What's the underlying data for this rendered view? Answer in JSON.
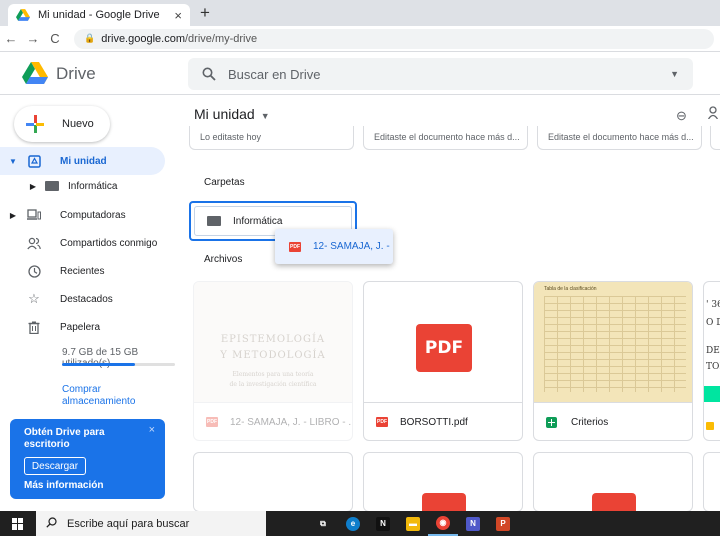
{
  "browser": {
    "tab_title": "Mi unidad - Google Drive",
    "tab_close": "×",
    "new_tab": "+",
    "back": "←",
    "forward": "→",
    "reload": "C",
    "url_host": "drive.google.com",
    "url_path": "/drive/my-drive"
  },
  "header": {
    "brand": "Drive",
    "search_placeholder": "Buscar en Drive"
  },
  "sidebar": {
    "new_label": "Nuevo",
    "items": [
      {
        "label": "Mi unidad"
      },
      {
        "label": "Informática"
      },
      {
        "label": "Computadoras"
      },
      {
        "label": "Compartidos conmigo"
      },
      {
        "label": "Recientes"
      },
      {
        "label": "Destacados"
      },
      {
        "label": "Papelera"
      }
    ],
    "storage_text": "9.7 GB de 15 GB utilizado(s)",
    "storage_fraction": 0.65,
    "buy_label": "Comprar almacenamiento"
  },
  "promo": {
    "title": "Obtén Drive para escritorio",
    "close": "×",
    "download": "Descargar",
    "more": "Más información"
  },
  "main": {
    "title": "Mi unidad",
    "quick_access": [
      "Lo editaste hoy",
      "Editaste el documento hace más d...",
      "Editaste el documento hace más d...",
      "E"
    ],
    "folders_label": "Carpetas",
    "folder_name": "Informática",
    "drag_file": "12- SAMAJA, J. - LI",
    "files_label": "Archivos",
    "files": [
      {
        "name": "12- SAMAJA, J. - LIBRO - ...",
        "thumb_lines": [
          "EPISTEMOLOGÍA",
          "Y METODOLOGÍA"
        ],
        "thumb_sub": [
          "Elementos para una teoría",
          "de la investigación científica"
        ]
      },
      {
        "name": "BORSOTTI.pdf",
        "thumb_badge": "PDF"
      },
      {
        "name": "Criterios",
        "thumb_header": "Tabla de la clasificación"
      }
    ],
    "partial_doc_lines": [
      "' 36",
      "O DE",
      "DE E",
      "TOR"
    ],
    "row2_badge": "PDF"
  },
  "taskbar": {
    "search_placeholder": "Escribe aquí para buscar",
    "apps": [
      {
        "name": "task-view",
        "color": "#202020",
        "glyph": "⧉"
      },
      {
        "name": "edge",
        "color": "#0f7ecb",
        "glyph": "e"
      },
      {
        "name": "netflix",
        "color": "#111111",
        "glyph": "N"
      },
      {
        "name": "explorer",
        "color": "#f2b90b",
        "glyph": "▬"
      },
      {
        "name": "chrome",
        "color": "#ea4335",
        "glyph": "◉"
      },
      {
        "name": "teams",
        "color": "#5059c9",
        "glyph": "N"
      },
      {
        "name": "powerpoint",
        "color": "#d24726",
        "glyph": "P"
      }
    ]
  }
}
